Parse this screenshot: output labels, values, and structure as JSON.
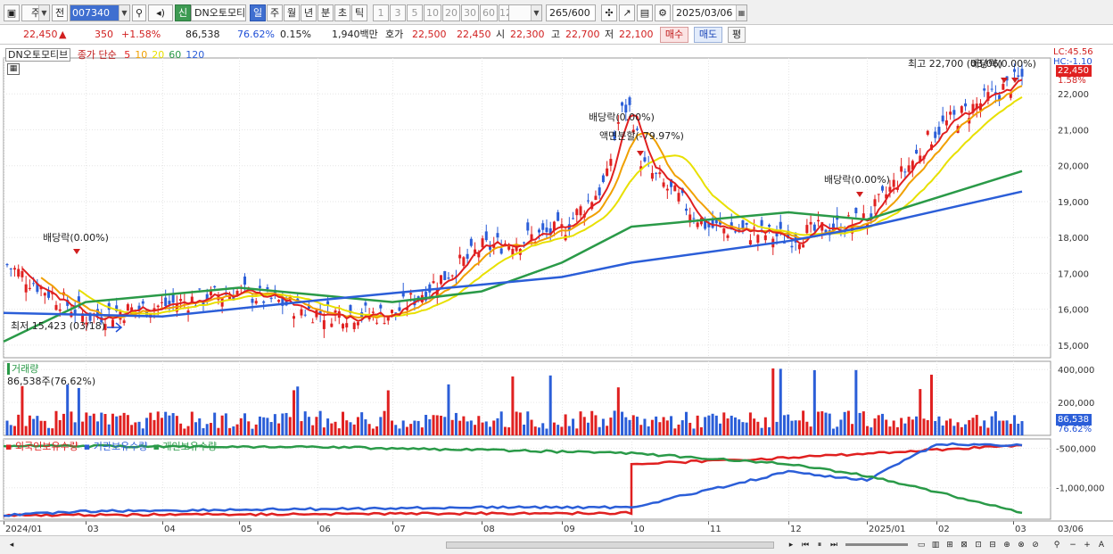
{
  "toolbar": {
    "period_prefix": "주",
    "period_prev": "전",
    "stock_code": "007340",
    "new_badge": "신",
    "stock_name": "DN오토모티",
    "periods": [
      {
        "label": "일",
        "selected": true
      },
      {
        "label": "주",
        "selected": false
      },
      {
        "label": "월",
        "selected": false
      },
      {
        "label": "년",
        "selected": false
      },
      {
        "label": "분",
        "selected": false
      },
      {
        "label": "초",
        "selected": false
      },
      {
        "label": "틱",
        "selected": false
      }
    ],
    "intervals": [
      "1",
      "3",
      "5",
      "10",
      "20",
      "30",
      "60",
      "120"
    ],
    "count": "265",
    "count_total": "/600",
    "date": "2025/03/06"
  },
  "quote": {
    "price": "22,450",
    "arrow": "▲",
    "change": "350",
    "change_pct": "+1.58%",
    "volume": "86,538",
    "volume_ratio": "76.62%",
    "turnover": "0.15%",
    "amount": "1,940백만",
    "ask_label": "호가",
    "ask1": "22,500",
    "bid1": "22,450",
    "open_label": "시",
    "open": "22,300",
    "high_label": "고",
    "high": "22,700",
    "low_label": "저",
    "low": "22,100",
    "buy_label": "매수",
    "sell_label": "매도",
    "avg_label": "평"
  },
  "price_pane": {
    "stock_label": "DN오토모티브",
    "ma_prefix": "종가 단순",
    "ma_periods": [
      {
        "label": "5",
        "color": "#e02020"
      },
      {
        "label": "10",
        "color": "#f0a000"
      },
      {
        "label": "20",
        "color": "#e8e000"
      },
      {
        "label": "60",
        "color": "#2a9a48"
      },
      {
        "label": "120",
        "color": "#2b5ed8"
      }
    ],
    "right_top_lc": "LC:45.56",
    "right_top_hc": "HC:-1.10",
    "price_tag": "22,450",
    "price_tag_pct": "1.58%",
    "annotations": [
      "배당락(0.00%)",
      "배당락(0.00%)",
      "액면분할(-79.97%)",
      "배당락(0.00%)",
      "최고 22,700 (03/06)",
      "배당락(0.00%)",
      "최저 15,423 (03/18)"
    ]
  },
  "volume_pane": {
    "label": "거래량",
    "sub_label": "86,538주(76.62%)",
    "tag_value": "86,538",
    "tag_pct": "76.62%"
  },
  "holding_pane": {
    "labels": [
      "외국인보유수량",
      "기관보유수량",
      "개인보유수량"
    ],
    "colors": [
      "#e02020",
      "#2b5ed8",
      "#2a9a48"
    ]
  },
  "x_axis": {
    "labels": [
      "2024/01",
      "03",
      "04",
      "05",
      "06",
      "07",
      "08",
      "09",
      "10",
      "11",
      "12",
      "2025/01",
      "02",
      "03"
    ],
    "right_label": "03/06"
  },
  "chart_data": {
    "type": "candlestick",
    "panes": [
      {
        "name": "price",
        "y_ticks": [
          15000,
          16000,
          17000,
          18000,
          19000,
          20000,
          21000,
          22000
        ],
        "y_range": [
          14650,
          23000
        ],
        "close_points": [
          {
            "x": "2024/01",
            "y": 17300
          },
          {
            "x": "03",
            "y": 15800
          },
          {
            "x": "04",
            "y": 16100
          },
          {
            "x": "05",
            "y": 16500
          },
          {
            "x": "06",
            "y": 15900
          },
          {
            "x": "07",
            "y": 15850
          },
          {
            "x": "08",
            "y": 17700
          },
          {
            "x": "09",
            "y": 18200
          },
          {
            "x": "10",
            "y": 20300
          },
          {
            "x": "11",
            "y": 18300
          },
          {
            "x": "12",
            "y": 18000
          },
          {
            "x": "2025/01",
            "y": 18500
          },
          {
            "x": "02",
            "y": 21000
          },
          {
            "x": "03",
            "y": 22450
          }
        ],
        "ma60_points": [
          {
            "x": "2024/01",
            "y": 15100
          },
          {
            "x": "03",
            "y": 16200
          },
          {
            "x": "05",
            "y": 16600
          },
          {
            "x": "07",
            "y": 16200
          },
          {
            "x": "08",
            "y": 16500
          },
          {
            "x": "09",
            "y": 17300
          },
          {
            "x": "10",
            "y": 18300
          },
          {
            "x": "12",
            "y": 18700
          },
          {
            "x": "2025/01",
            "y": 18500
          },
          {
            "x": "03",
            "y": 19850
          }
        ],
        "ma120_points": [
          {
            "x": "2024/01",
            "y": 15900
          },
          {
            "x": "04",
            "y": 15800
          },
          {
            "x": "06",
            "y": 16250
          },
          {
            "x": "07",
            "y": 16450
          },
          {
            "x": "09",
            "y": 16900
          },
          {
            "x": "10",
            "y": 17300
          },
          {
            "x": "12",
            "y": 17900
          },
          {
            "x": "2025/01",
            "y": 18300
          },
          {
            "x": "03",
            "y": 19280
          }
        ]
      },
      {
        "name": "volume",
        "y_ticks": [
          200000,
          400000
        ],
        "y_range": [
          0,
          450000
        ],
        "current_volume": 86538
      },
      {
        "name": "holdings",
        "y_ticks": [
          -500000,
          -1000000
        ],
        "series": [
          {
            "name": "외국인보유수량",
            "points": [
              {
                "x": "2024/01",
                "y": -1350000
              },
              {
                "x": "10",
                "y": -1320000
              },
              {
                "x": "10",
                "y": -700000
              },
              {
                "x": "12",
                "y": -620000
              },
              {
                "x": "03",
                "y": -460000
              }
            ]
          },
          {
            "name": "기관보유수량",
            "points": [
              {
                "x": "2024/01",
                "y": -1350000
              },
              {
                "x": "03",
                "y": -1300000
              },
              {
                "x": "08",
                "y": -1250000
              },
              {
                "x": "10",
                "y": -1250000
              },
              {
                "x": "12",
                "y": -800000
              },
              {
                "x": "2025/01",
                "y": -900000
              },
              {
                "x": "02",
                "y": -450000
              },
              {
                "x": "03",
                "y": -460000
              }
            ]
          },
          {
            "name": "개인보유수량",
            "points": [
              {
                "x": "2024/01",
                "y": -470000
              },
              {
                "x": "06",
                "y": -480000
              },
              {
                "x": "10",
                "y": -560000
              },
              {
                "x": "12",
                "y": -700000
              },
              {
                "x": "2025/01",
                "y": -850000
              },
              {
                "x": "02",
                "y": -1050000
              },
              {
                "x": "03",
                "y": -1320000
              }
            ]
          }
        ]
      }
    ]
  }
}
